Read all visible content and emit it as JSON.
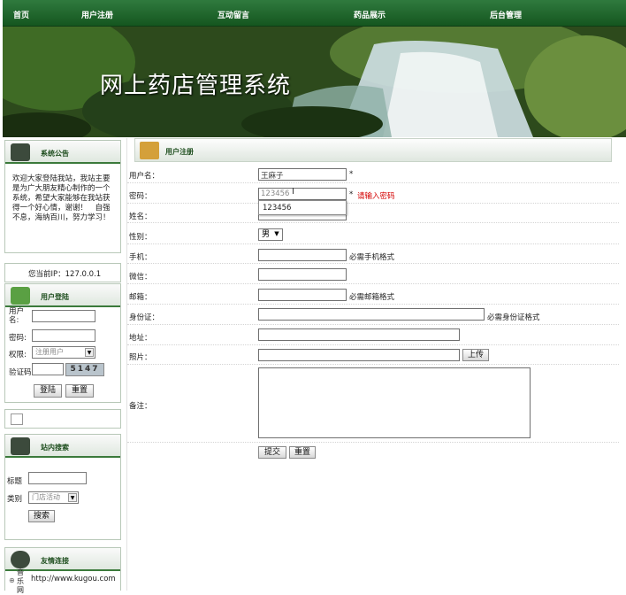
{
  "nav": {
    "items": [
      "首页",
      "用户注册",
      "互动留言",
      "药品展示",
      "后台管理"
    ]
  },
  "banner": {
    "title": "网上药店管理系统"
  },
  "sidebar": {
    "announcement": {
      "title": "系统公告",
      "text": "欢迎大家登陆我站，我站主要是为广大朋友精心制作的一个系统，希望大家能够在我站获得一个好心情，谢谢！　自强不息，海纳百川，努力学习！"
    },
    "ip": {
      "text": "您当前IP：127.0.0.1"
    },
    "login": {
      "title": "用户登陆",
      "username_label": "用户名:",
      "password_label": "密码:",
      "role_label": "权限:",
      "role_value": "注册用户",
      "captcha_label": "验证码",
      "captcha_text": "5147",
      "login_button": "登陆",
      "reset_button": "重置"
    },
    "search": {
      "title": "站内搜索",
      "title_label": "标题",
      "category_label": "类别",
      "category_value": "门店活动",
      "search_button": "搜索"
    },
    "links": {
      "title": "友情连接",
      "item_name": "音乐网",
      "item_url": "http://www.kugou.com"
    }
  },
  "form": {
    "title": "用户注册",
    "username_label": "用户名：",
    "username_value": "王麻子",
    "required_mark": "*",
    "password_label": "密码：",
    "password_value": "123456",
    "password_error": "请输入密码",
    "autocomplete_option": "123456",
    "name_label": "姓名：",
    "gender_label": "性别：",
    "gender_value": "男",
    "phone_label": "手机：",
    "phone_hint": "必需手机格式",
    "wechat_label": "微信：",
    "email_label": "邮箱：",
    "email_hint": "必需邮箱格式",
    "idcard_label": "身份证：",
    "idcard_hint": "必需身份证格式",
    "address_label": "地址：",
    "photo_label": "照片：",
    "upload_button": "上传",
    "remark_label": "备注：",
    "submit_button": "提交",
    "reset_button": "重置"
  }
}
